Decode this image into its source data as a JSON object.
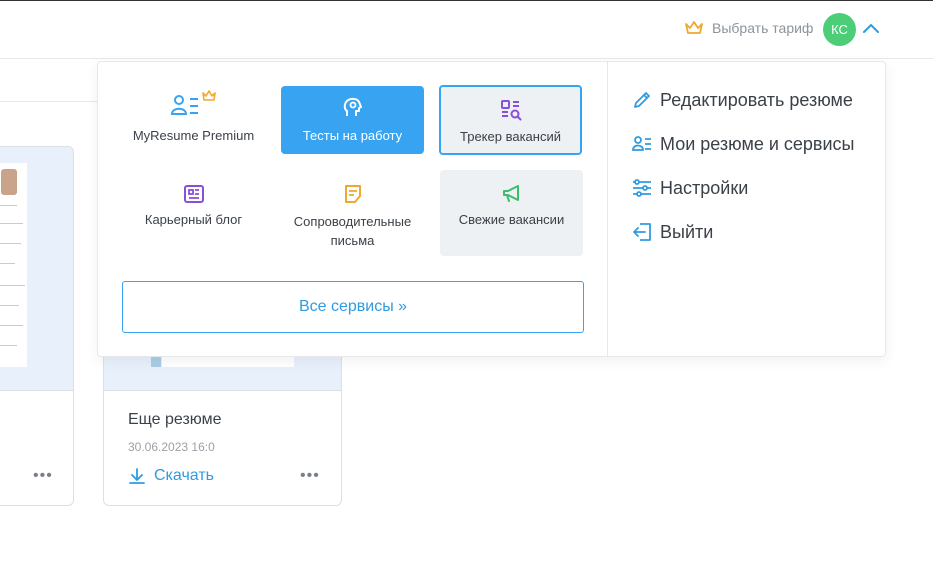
{
  "header": {
    "plan_label": "Выбрать тариф",
    "avatar_initials": "КС"
  },
  "services": [
    {
      "label": "MyResume Premium"
    },
    {
      "label": "Тесты на работу"
    },
    {
      "label": "Трекер вакансий"
    },
    {
      "label": "Карьерный блог"
    },
    {
      "label": "Сопроводительные письма"
    },
    {
      "label": "Свежие вакансии"
    }
  ],
  "all_services_label": "Все сервисы »",
  "menu": [
    {
      "label": "Редактировать резюме"
    },
    {
      "label": "Мои резюме и сервисы"
    },
    {
      "label": "Настройки"
    },
    {
      "label": "Выйти"
    }
  ],
  "cards": {
    "second": {
      "title": "Еще резюме",
      "date": "30.06.2023 16:0",
      "download_label": "Скачать"
    },
    "more_glyph": "•••"
  },
  "colors": {
    "accent": "#38a4f1",
    "premium": "#f0a830",
    "avatar": "#4cce78",
    "purple": "#8a4fd9",
    "green": "#3cbf6a"
  }
}
